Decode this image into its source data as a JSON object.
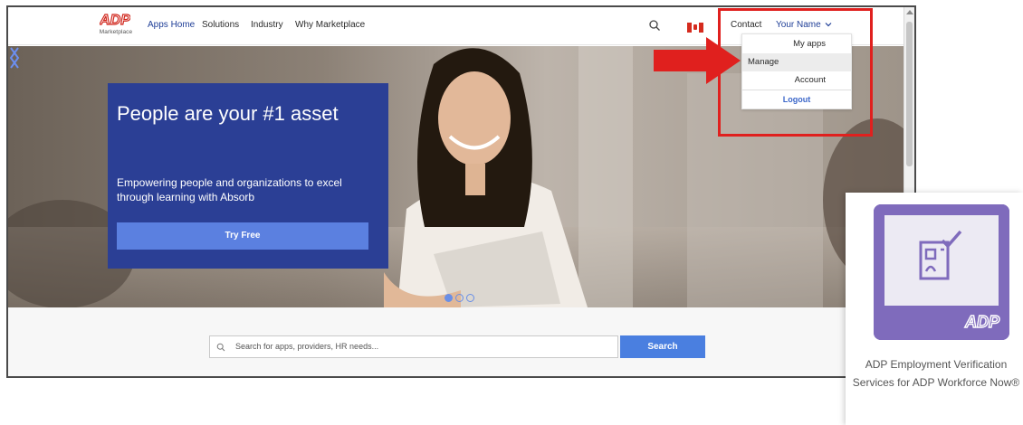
{
  "nav": {
    "logo_sub": "Marketplace",
    "links": [
      "Apps Home",
      "Solutions",
      "Industry",
      "Why Marketplace"
    ],
    "contact": "Contact",
    "username": "Your Name"
  },
  "hero": {
    "title": "People are your #1 asset",
    "body": "Empowering people and organizations to excel through learning with Absorb",
    "cta": "Try Free",
    "active_slide": 1,
    "slide_count": 3
  },
  "search": {
    "placeholder": "Search for apps, providers, HR needs...",
    "button": "Search"
  },
  "dropdown": {
    "items": [
      "My apps",
      "Manage",
      "Account",
      "Logout"
    ]
  },
  "app_card": {
    "name": "ADP Employment Verification Services for ADP Workforce Now®"
  },
  "colors": {
    "brand_blue": "#2b3f95",
    "button_blue": "#4a7fe0",
    "link_blue": "#1f3e97",
    "highlight_red": "#e0201e",
    "tile_purple": "#7f6bbc"
  },
  "icons": [
    "adp-logo-icon",
    "search-icon",
    "canada-flag-icon",
    "chevron-down-icon",
    "chevron-left-icon",
    "chevron-right-icon",
    "red-arrow-icon",
    "verification-app-icon"
  ]
}
